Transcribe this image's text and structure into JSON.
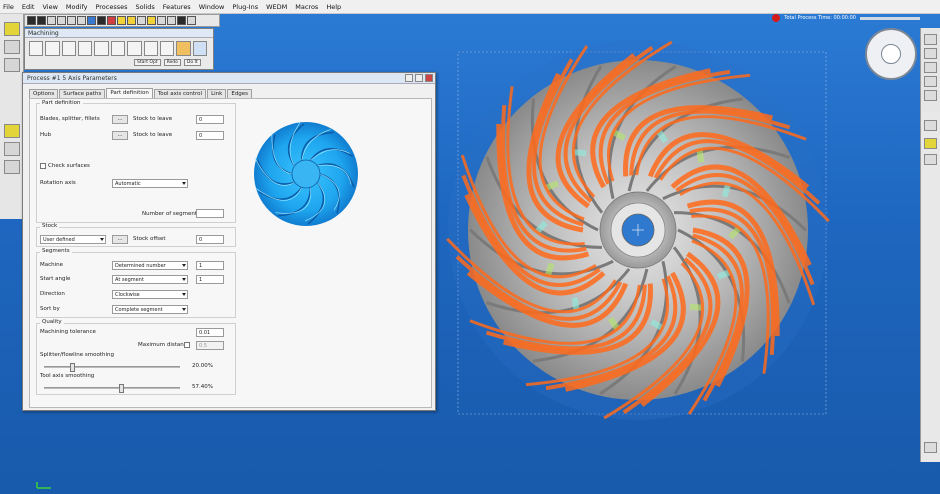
{
  "menu": [
    "File",
    "Edit",
    "View",
    "Modify",
    "Processes",
    "Solids",
    "Features",
    "Window",
    "Plug-Ins",
    "WEDM",
    "Macros",
    "Help"
  ],
  "status": {
    "process_time": "Total Process Time: 00:00:00"
  },
  "machining": {
    "title": "Machining",
    "buttons": [
      "Start Opt",
      "Redo",
      "Do It"
    ]
  },
  "dialog": {
    "title": "Process #1 5 Axis Parameters",
    "tabs": [
      "Options",
      "Surface paths",
      "Part definition",
      "Tool axis control",
      "Link",
      "Edges"
    ],
    "active_tab": "Part definition",
    "part_definition": {
      "group": "Part definition",
      "blades_label": "Blades, splitter, fillets",
      "hub_label": "Hub",
      "stock_to_leave_label": "Stock to leave",
      "blades_stock": "0",
      "hub_stock": "0",
      "check_surfaces_label": "Check surfaces",
      "rotation_axis_label": "Rotation axis",
      "rotation_axis": "Automatic",
      "segments_count_label": "Number of segments",
      "segments_count": "",
      "btn_dots": "..."
    },
    "stock": {
      "group": "Stock",
      "type": "User defined",
      "offset_label": "Stock offset",
      "offset": "0"
    },
    "segments": {
      "group": "Segments",
      "machine_label": "Machine",
      "machine": "Determined number",
      "machine_value": "1",
      "start_angle_label": "Start angle",
      "start_angle": "At segment",
      "start_angle_value": "1",
      "direction_label": "Direction",
      "direction": "Clockwise",
      "sort_by_label": "Sort by",
      "sort_by": "Complete segment"
    },
    "quality": {
      "group": "Quality",
      "tolerance_label": "Machining tolerance",
      "tolerance": "0.01",
      "max_distance_label": "Maximum distance",
      "max_distance": "0.5",
      "splitter_label": "Splitter/flowline smoothing",
      "splitter_value": "20.00%",
      "splitter_level": 0.2,
      "tool_axis_label": "Tool axis smoothing",
      "tool_axis_value": "57.40%",
      "tool_axis_level": 0.574
    }
  },
  "colors": {
    "viewport": "#1e66bf",
    "toolpath": "#ff6a1a",
    "impeller": "#c8c8c8"
  }
}
